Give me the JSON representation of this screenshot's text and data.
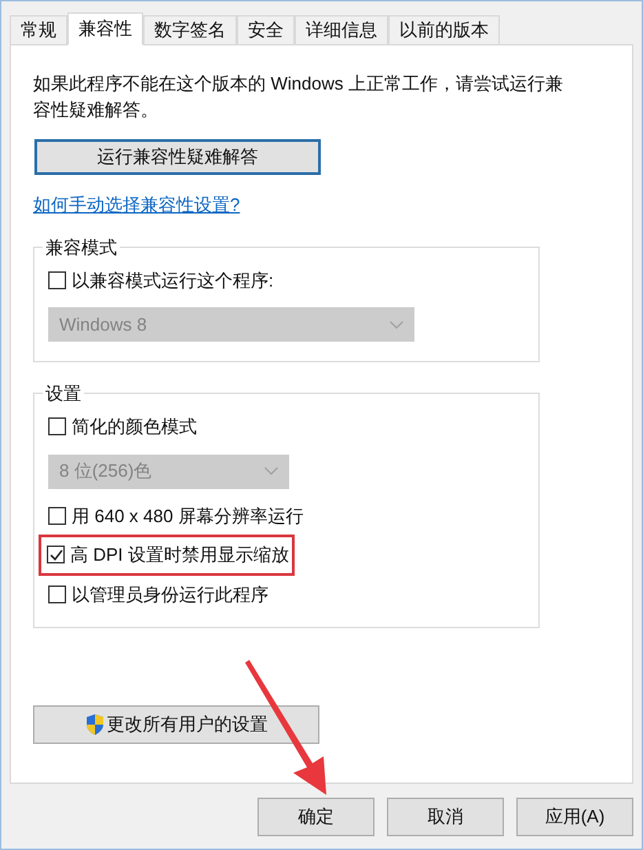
{
  "tabs": [
    {
      "label": "常规",
      "selected": false
    },
    {
      "label": "兼容性",
      "selected": true
    },
    {
      "label": "数字签名",
      "selected": false
    },
    {
      "label": "安全",
      "selected": false
    },
    {
      "label": "详细信息",
      "selected": false
    },
    {
      "label": "以前的版本",
      "selected": false
    }
  ],
  "intro": "如果此程序不能在这个版本的 Windows 上正常工作，请尝试运行兼容性疑难解答。",
  "troubleshoot_button": "运行兼容性疑难解答",
  "help_link": "如何手动选择兼容性设置?",
  "compat_mode": {
    "title": "兼容模式",
    "items": [
      {
        "kind": "checkbox",
        "label": "以兼容模式运行这个程序:",
        "checked": false,
        "highlighted": false
      },
      {
        "kind": "dropdown",
        "value": "Windows 8",
        "disabled": true
      }
    ]
  },
  "settings": {
    "title": "设置",
    "items": [
      {
        "kind": "checkbox",
        "label": "简化的颜色模式",
        "checked": false,
        "highlighted": false
      },
      {
        "kind": "dropdown",
        "value": "8 位(256)色",
        "disabled": true
      },
      {
        "kind": "checkbox",
        "label": "用 640 x 480 屏幕分辨率运行",
        "checked": false,
        "highlighted": false
      },
      {
        "kind": "checkbox",
        "label": "高 DPI 设置时禁用显示缩放",
        "checked": true,
        "highlighted": true
      },
      {
        "kind": "checkbox",
        "label": "以管理员身份运行此程序",
        "checked": false,
        "highlighted": false
      }
    ]
  },
  "change_all_button": "更改所有用户的设置",
  "buttons": [
    "确定",
    "取消",
    "应用(A)"
  ]
}
